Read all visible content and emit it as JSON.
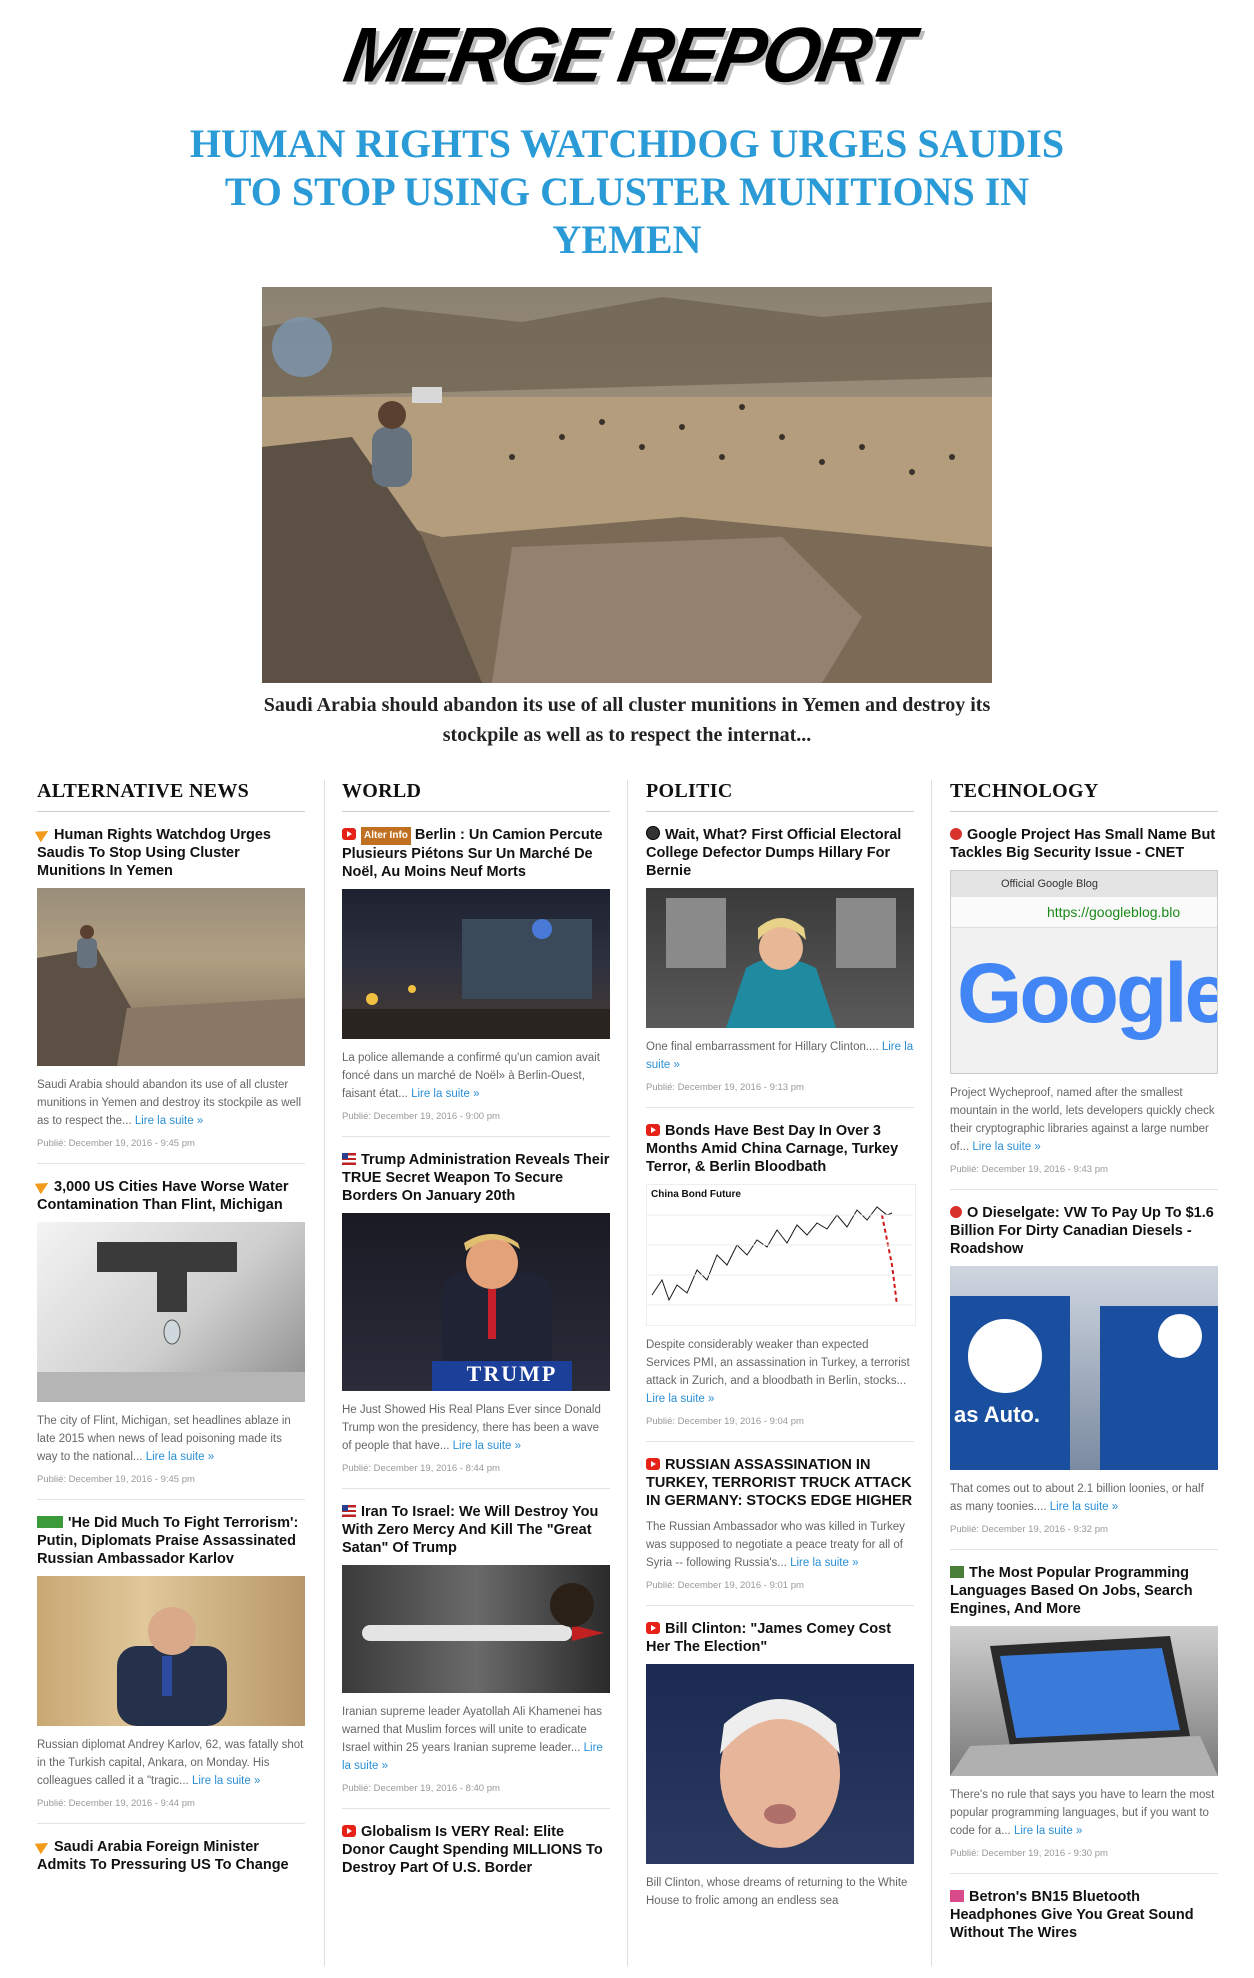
{
  "site": {
    "logo": "MERGE REPORT"
  },
  "hero": {
    "title": "HUMAN RIGHTS WATCHDOG URGES SAUDIS TO STOP USING CLUSTER MUNITIONS IN YEMEN",
    "caption": "Saudi Arabia should abandon its use of all cluster munitions in Yemen and destroy its stockpile as well as to respect the internat..."
  },
  "read_more": "Lire la suite »",
  "columns": [
    {
      "title": "ALTERNATIVE NEWS",
      "articles": [
        {
          "title": "Human Rights Watchdog Urges Saudis To Stop Using Cluster Munitions In Yemen",
          "source_icon": "arrow-icon",
          "desc": "Saudi Arabia should abandon its use of all cluster munitions in Yemen and destroy its stockpile as well as to respect the...",
          "date": "Publié: December 19, 2016 - 9:45 pm",
          "thumb": "yemen"
        },
        {
          "title": "3,000 US Cities Have Worse Water Contamination Than Flint, Michigan",
          "source_icon": "arrow-icon",
          "desc": "The city of Flint, Michigan, set headlines ablaze in late 2015 when news of lead poisoning made its way to the national...",
          "date": "Publié: December 19, 2016 - 9:45 pm",
          "thumb": "faucet"
        },
        {
          "title": "'He Did Much To Fight Terrorism': Putin, Diplomats Praise Assassinated Russian Ambassador Karlov",
          "source_icon": "rt-icon",
          "desc": "Russian diplomat Andrey Karlov, 62, was fatally shot in the Turkish capital, Ankara, on Monday. His colleagues called it a \"tragic...",
          "date": "Publié: December 19, 2016 - 9:44 pm",
          "thumb": "karlov"
        },
        {
          "title": "Saudi Arabia Foreign Minister Admits To Pressuring US To Change",
          "source_icon": "arrow-icon",
          "desc": "",
          "date": "",
          "thumb": ""
        }
      ]
    },
    {
      "title": "WORLD",
      "articles": [
        {
          "title": "Berlin : Un Camion Percute Plusieurs Piétons Sur Un Marché De Noël, Au Moins Neuf Morts",
          "source_icon": "video-icon",
          "source_tag": "Alter Info",
          "desc": "La police allemande a confirmé qu'un camion avait foncé dans un marché de Noël» à Berlin-Ouest, faisant état...",
          "date": "Publié: December 19, 2016 - 9:00 pm",
          "thumb": "berlin"
        },
        {
          "title": "Trump Administration Reveals Their TRUE Secret Weapon To Secure Borders On January 20th",
          "source_icon": "flag-icon",
          "desc": "He Just Showed His Real Plans Ever since Donald Trump won the presidency, there has been a wave of people that have...",
          "date": "Publié: December 19, 2016 - 8:44 pm",
          "thumb": "trump",
          "thumb_label": "TRUMP"
        },
        {
          "title": "Iran To Israel: We Will Destroy You With Zero Mercy And Kill The \"Great Satan\" Of Trump",
          "source_icon": "flag-icon",
          "desc": "Iranian supreme leader Ayatollah Ali Khamenei has warned that Muslim forces will unite to eradicate Israel within 25 years Iranian supreme leader...",
          "date": "Publié: December 19, 2016 - 8:40 pm",
          "thumb": "iran"
        },
        {
          "title": "Globalism Is VERY Real: Elite Donor Caught Spending MILLIONS To Destroy Part Of U.S. Border",
          "source_icon": "video-icon",
          "desc": "",
          "date": "",
          "thumb": ""
        }
      ]
    },
    {
      "title": "POLITIC",
      "articles": [
        {
          "title": "Wait, What? First Official Electoral College Defector Dumps Hillary For Bernie",
          "source_icon": "globe-icon",
          "desc": "One final embarrassment for Hillary Clinton....",
          "date": "Publié: December 19, 2016 - 9:13 pm",
          "thumb": "hillary"
        },
        {
          "title": "Bonds Have Best Day In Over 3 Months Amid China Carnage, Turkey Terror, & Berlin Bloodbath",
          "source_icon": "video-icon",
          "desc": "Despite considerably weaker than expected Services PMI, an assassination in Turkey, a terrorist attack in Zurich, and a bloodbath in Berlin, stocks...",
          "date": "Publié: December 19, 2016 - 9:04 pm",
          "thumb": "chart",
          "thumb_label": "China Bond Future"
        },
        {
          "title": "RUSSIAN ASSASSINATION IN TURKEY, TERRORIST TRUCK ATTACK IN GERMANY: STOCKS EDGE HIGHER",
          "source_icon": "video-icon",
          "desc": "The Russian Ambassador who was killed in Turkey was supposed to negotiate a peace treaty for all of Syria -- following Russia's...",
          "date": "Publié: December 19, 2016 - 9:01 pm",
          "thumb": ""
        },
        {
          "title": "Bill Clinton: \"James Comey Cost Her The Election\"",
          "source_icon": "video-icon",
          "desc": "Bill Clinton, whose dreams of returning to the White House to frolic among an endless sea",
          "date": "",
          "thumb": "clinton"
        }
      ]
    },
    {
      "title": "TECHNOLOGY",
      "articles": [
        {
          "title": "Google Project Has Small Name But Tackles Big Security Issue - CNET",
          "source_icon": "cnet-icon",
          "desc": "Project Wycheproof, named after the smallest mountain in the world, lets developers quickly check their cryptographic libraries against a large number of...",
          "date": "Publié: December 19, 2016 - 9:43 pm",
          "thumb": "google",
          "thumb_tab": "Official Google Blog",
          "thumb_url": "https://googleblog.blo",
          "thumb_logo": "Google"
        },
        {
          "title": "O Dieselgate: VW To Pay Up To $1.6 Billion For Dirty Canadian Diesels - Roadshow",
          "source_icon": "cnet-icon",
          "desc": "That comes out to about 2.1 billion loonies, or half as many toonies....",
          "date": "Publié: December 19, 2016 - 9:32 pm",
          "thumb": "vw",
          "thumb_label": "as Auto."
        },
        {
          "title": "The Most Popular Programming Languages Based On Jobs, Search Engines, And More",
          "source_icon": "chart-icon",
          "desc": "There's no rule that says you have to learn the most popular programming languages, but if you want to code for a...",
          "date": "Publié: December 19, 2016 - 9:30 pm",
          "thumb": "laptop"
        },
        {
          "title": "Betron's BN15 Bluetooth Headphones Give You Great Sound Without The Wires",
          "source_icon": "pink-icon",
          "desc": "",
          "date": "",
          "thumb": ""
        }
      ]
    }
  ]
}
